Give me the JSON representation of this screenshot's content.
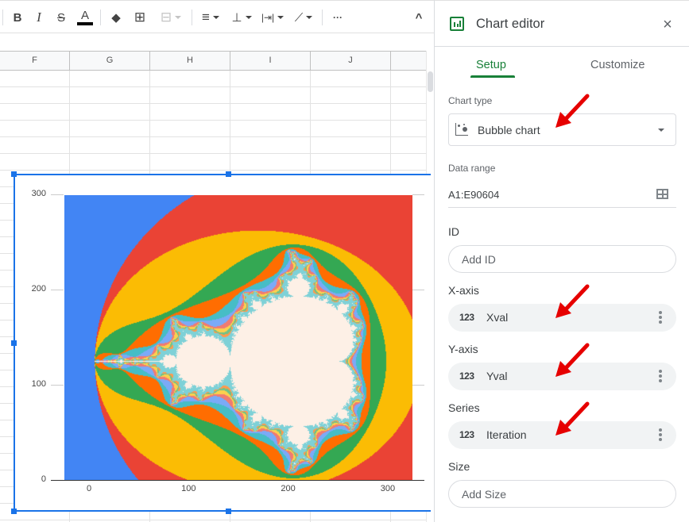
{
  "toolbar": {
    "buttons": [
      {
        "name": "bold",
        "glyph": "B"
      },
      {
        "name": "italic",
        "glyph": "I"
      },
      {
        "name": "strikethrough",
        "glyph": "S"
      },
      {
        "name": "text-color",
        "glyph": "A"
      },
      {
        "name": "fill-color",
        "glyph": "◆"
      },
      {
        "name": "borders",
        "glyph": "⊞"
      },
      {
        "name": "merge-cells",
        "glyph": "⊟"
      },
      {
        "name": "horizontal-align",
        "glyph": "≡"
      },
      {
        "name": "vertical-align",
        "glyph": "⊥"
      },
      {
        "name": "text-wrapping",
        "glyph": "|⇥|"
      },
      {
        "name": "text-rotation",
        "glyph": "⟋"
      },
      {
        "name": "more",
        "glyph": "···"
      },
      {
        "name": "collapse",
        "glyph": "^"
      }
    ],
    "text_color_underline": "#000000"
  },
  "sheet": {
    "columns": [
      "F",
      "G",
      "H",
      "I",
      "J",
      ""
    ]
  },
  "chart_data": {
    "type": "scatter",
    "subtype": "bubble",
    "title": "",
    "xlabel": "",
    "ylabel": "",
    "x_ticks": [
      "0",
      "100",
      "200",
      "300"
    ],
    "y_ticks": [
      "0",
      "100",
      "200",
      "300"
    ],
    "xlim": [
      -25,
      325
    ],
    "ylim": [
      0,
      300
    ],
    "x_field": "Xval",
    "y_field": "Yval",
    "series_field": "Iteration",
    "description": "Mandelbrot set rendered as bubble chart; each point colored by iteration count",
    "palette": [
      "#4285f4",
      "#ea4335",
      "#fbbc04",
      "#34a853",
      "#ff6d01",
      "#46bdc6",
      "#7baaf7",
      "#f07b72",
      "#fcd04f",
      "#71c287",
      "#ff994d",
      "#7ed1d7"
    ],
    "inside_color": "#fdf0e6",
    "grid": true,
    "legend": "none"
  },
  "panel": {
    "title": "Chart editor",
    "close_icon": "×",
    "tabs": [
      {
        "label": "Setup",
        "active": true
      },
      {
        "label": "Customize",
        "active": false
      }
    ],
    "chart_type_label": "Chart type",
    "chart_type_value": "Bubble chart",
    "data_range_label": "Data range",
    "data_range_value": "A1:E90604",
    "id_label": "ID",
    "id_placeholder": "Add ID",
    "xaxis_label": "X-axis",
    "xaxis_value": "Xval",
    "yaxis_label": "Y-axis",
    "yaxis_value": "Yval",
    "series_label": "Series",
    "series_value": "Iteration",
    "size_label": "Size",
    "size_placeholder": "Add Size",
    "numeric_type_badge": "123",
    "accent": "#188038"
  },
  "annotations": {
    "arrow_color": "#e60000"
  }
}
